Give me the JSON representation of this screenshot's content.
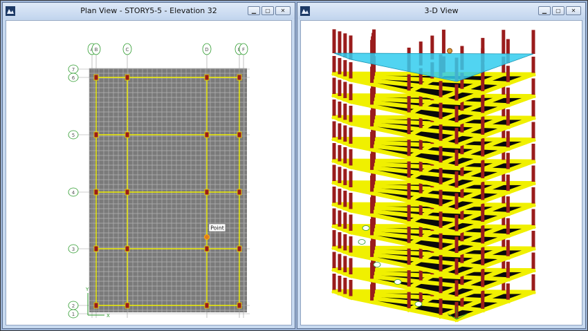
{
  "left_window": {
    "title": "Plan View - STORY5-5 - Elevation 32",
    "buttons": [
      "minimize",
      "maximize",
      "close"
    ],
    "grid_x_labels": [
      "A",
      "B",
      "C",
      "D",
      "E",
      "F"
    ],
    "grid_y_labels": [
      "7",
      "6",
      "5",
      "4",
      "3",
      "2",
      "1"
    ],
    "point_label": "Point",
    "axis_x": "X",
    "axis_y": "Y"
  },
  "right_window": {
    "title": "3-D View",
    "buttons": [
      "minimize",
      "maximize",
      "close"
    ]
  },
  "colors": {
    "slab": "#7a7a7a",
    "mesh": "#b5b5b5",
    "beam": "#f0f000",
    "column": "#9a1c1c",
    "grid_bubble": "#2a9a2a",
    "roof": "#33ccee"
  }
}
